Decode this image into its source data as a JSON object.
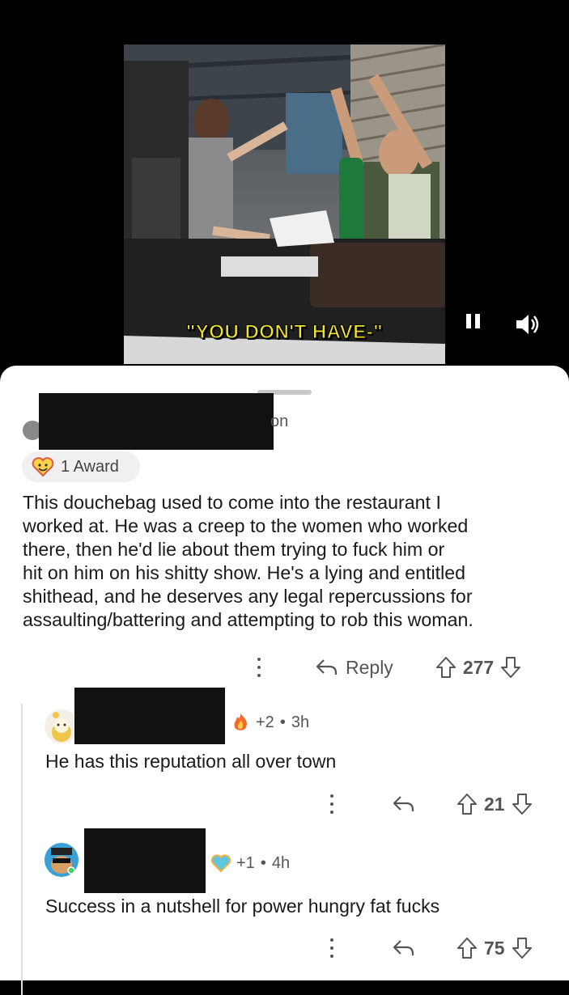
{
  "video": {
    "caption": "\"YOU DON'T HAVE-\""
  },
  "main_comment": {
    "partial_text": "on",
    "award_label": "1 Award",
    "body_lines": [
      "This douchebag used to come into the restaurant I",
      "worked at. He was a creep to the women who worked",
      "there, then he'd lie about them trying to fuck him or",
      "hit on him on his shitty show. He's a lying and entitled",
      "shithead, and he deserves any legal repercussions for",
      "assaulting/battering and attempting to rob this woman."
    ],
    "reply_label": "Reply",
    "vote_count": "277"
  },
  "replies": [
    {
      "award_count": "+2",
      "separator": "•",
      "time": "3h",
      "text": "He has this reputation all over town",
      "vote_count": "21"
    },
    {
      "award_count": "+1",
      "separator": "•",
      "time": "4h",
      "text": "Success in a nutshell for power hungry fat fucks",
      "vote_count": "75"
    }
  ],
  "colors": {
    "caption": "#f2e52a",
    "meta_text": "#555555",
    "body_text": "#1a1a1b"
  }
}
